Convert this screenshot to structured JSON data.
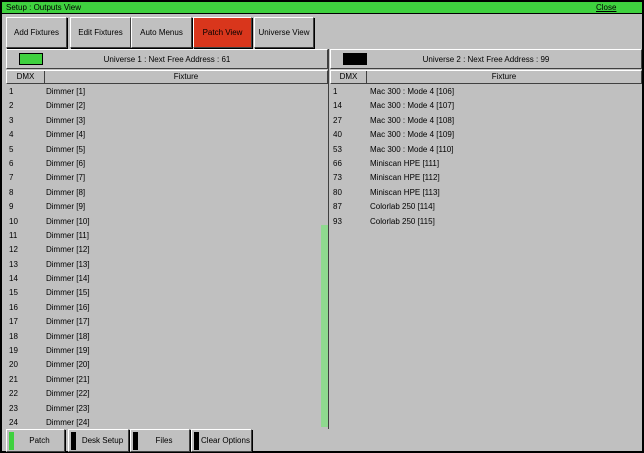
{
  "window": {
    "title": "Setup : Outputs View",
    "close_label": "Close"
  },
  "tabs": [
    {
      "label": "Add Fixtures",
      "active": false
    },
    {
      "label": "Edit Fixtures",
      "active": false
    },
    {
      "label": "Auto Menus",
      "active": false
    },
    {
      "label": "Patch View",
      "active": true
    },
    {
      "label": "Universe View",
      "active": false
    }
  ],
  "colors": {
    "title_bar": "#3fd13f",
    "active_tab": "#d9361c",
    "universe1_swatch": "#3fd13f",
    "universe2_swatch": "#000000",
    "scroll_thumb": "#8fd98f"
  },
  "universe1": {
    "label": "Universe 1 : Next Free Address : 61",
    "col_dmx": "DMX",
    "col_fixture": "Fixture",
    "rows": [
      {
        "dmx": "1",
        "fixture": "Dimmer [1]"
      },
      {
        "dmx": "2",
        "fixture": "Dimmer [2]"
      },
      {
        "dmx": "3",
        "fixture": "Dimmer [3]"
      },
      {
        "dmx": "4",
        "fixture": "Dimmer [4]"
      },
      {
        "dmx": "5",
        "fixture": "Dimmer [5]"
      },
      {
        "dmx": "6",
        "fixture": "Dimmer [6]"
      },
      {
        "dmx": "7",
        "fixture": "Dimmer [7]"
      },
      {
        "dmx": "8",
        "fixture": "Dimmer [8]"
      },
      {
        "dmx": "9",
        "fixture": "Dimmer [9]"
      },
      {
        "dmx": "10",
        "fixture": "Dimmer [10]"
      },
      {
        "dmx": "11",
        "fixture": "Dimmer [11]"
      },
      {
        "dmx": "12",
        "fixture": "Dimmer [12]"
      },
      {
        "dmx": "13",
        "fixture": "Dimmer [13]"
      },
      {
        "dmx": "14",
        "fixture": "Dimmer [14]"
      },
      {
        "dmx": "15",
        "fixture": "Dimmer [15]"
      },
      {
        "dmx": "16",
        "fixture": "Dimmer [16]"
      },
      {
        "dmx": "17",
        "fixture": "Dimmer [17]"
      },
      {
        "dmx": "18",
        "fixture": "Dimmer [18]"
      },
      {
        "dmx": "19",
        "fixture": "Dimmer [19]"
      },
      {
        "dmx": "20",
        "fixture": "Dimmer [20]"
      },
      {
        "dmx": "21",
        "fixture": "Dimmer [21]"
      },
      {
        "dmx": "22",
        "fixture": "Dimmer [22]"
      },
      {
        "dmx": "23",
        "fixture": "Dimmer [23]"
      },
      {
        "dmx": "24",
        "fixture": "Dimmer [24]"
      }
    ]
  },
  "universe2": {
    "label": "Universe 2 : Next Free Address : 99",
    "col_dmx": "DMX",
    "col_fixture": "Fixture",
    "rows": [
      {
        "dmx": "1",
        "fixture": "Mac 300 : Mode 4 [106]"
      },
      {
        "dmx": "14",
        "fixture": "Mac 300 : Mode 4 [107]"
      },
      {
        "dmx": "27",
        "fixture": "Mac 300 : Mode 4 [108]"
      },
      {
        "dmx": "40",
        "fixture": "Mac 300 : Mode 4 [109]"
      },
      {
        "dmx": "53",
        "fixture": "Mac 300 : Mode 4 [110]"
      },
      {
        "dmx": "66",
        "fixture": "Miniscan HPE [111]"
      },
      {
        "dmx": "73",
        "fixture": "Miniscan HPE [112]"
      },
      {
        "dmx": "80",
        "fixture": "Miniscan HPE [113]"
      },
      {
        "dmx": "87",
        "fixture": "Colorlab 250 [114]"
      },
      {
        "dmx": "93",
        "fixture": "Colorlab 250 [115]"
      }
    ]
  },
  "bottom_buttons": [
    {
      "label": "Patch",
      "active": true
    },
    {
      "label": "Desk Setup",
      "active": false
    },
    {
      "label": "Files",
      "active": false
    },
    {
      "label": "Clear Options",
      "active": false
    }
  ]
}
